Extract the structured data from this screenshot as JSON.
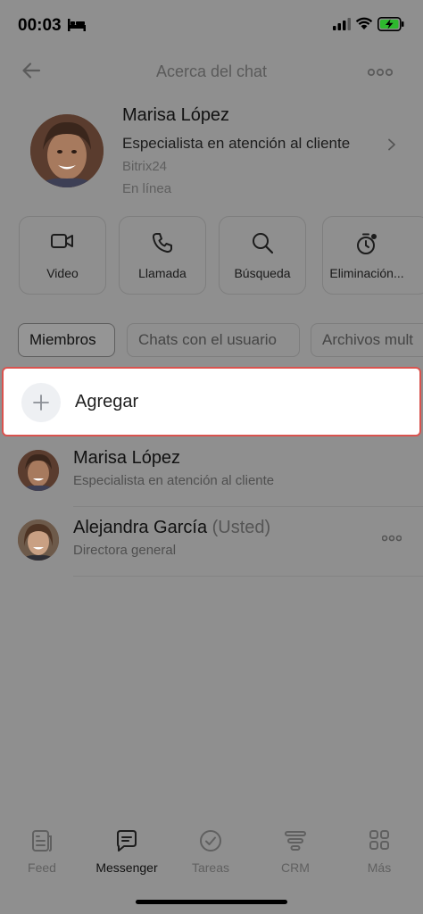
{
  "status_bar": {
    "time": "00:03"
  },
  "header": {
    "title": "Acerca del chat"
  },
  "profile": {
    "name": "Marisa López",
    "role": "Especialista en atención al cliente",
    "company": "Bitrix24",
    "status": "En línea"
  },
  "actions": [
    {
      "label": "Video",
      "icon": "video-camera-icon"
    },
    {
      "label": "Llamada",
      "icon": "phone-icon"
    },
    {
      "label": "Búsqueda",
      "icon": "search-icon"
    },
    {
      "label": "Eliminación...",
      "icon": "timer-icon"
    }
  ],
  "tabs": [
    {
      "label": "Miembros",
      "active": true
    },
    {
      "label": "Chats con el usuario",
      "active": false
    },
    {
      "label": "Archivos mult",
      "active": false
    }
  ],
  "add_member": {
    "label": "Agregar"
  },
  "members": [
    {
      "name": "Marisa López",
      "suffix": "",
      "role": "Especialista en atención al cliente"
    },
    {
      "name": "Alejandra García",
      "suffix": "(Usted)",
      "role": "Directora general"
    }
  ],
  "bottom_nav": [
    {
      "label": "Feed",
      "icon": "feed-icon",
      "active": false
    },
    {
      "label": "Messenger",
      "icon": "messenger-icon",
      "active": true
    },
    {
      "label": "Tareas",
      "icon": "tasks-check-icon",
      "active": false
    },
    {
      "label": "CRM",
      "icon": "crm-filter-icon",
      "active": false
    },
    {
      "label": "Más",
      "icon": "grid-icon",
      "active": false
    }
  ],
  "colors": {
    "highlight_border": "#d9534f",
    "overlay": "#8f8f8f"
  }
}
